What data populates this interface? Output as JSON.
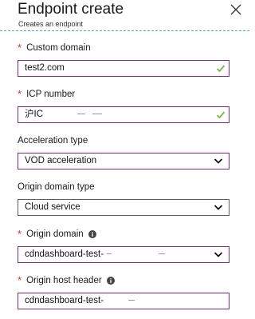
{
  "header": {
    "title": "Endpoint create",
    "subtitle": "Creates an endpoint"
  },
  "fields": {
    "custom_domain": {
      "label": "Custom domain",
      "required": "*",
      "value": "test2.com"
    },
    "icp_number": {
      "label": "ICP number",
      "required": "*",
      "value": "沪IC"
    },
    "acceleration_type": {
      "label": "Acceleration type",
      "value": "VOD acceleration"
    },
    "origin_domain_type": {
      "label": "Origin domain type",
      "value": "Cloud service"
    },
    "origin_domain": {
      "label": "Origin domain",
      "required": "*",
      "value": "cdndashboard-test-"
    },
    "origin_host_header": {
      "label": "Origin host header",
      "required": "*",
      "value": "cdndashboard-test-"
    }
  },
  "colors": {
    "required": "#d9302c",
    "valid_check": "#7ab648",
    "focus_border": "#7a2a7a",
    "divider": "#5aa7c9"
  },
  "icons": {
    "close": "close-icon",
    "check": "check-icon",
    "chevron": "chevron-down-icon",
    "info": "info-icon"
  }
}
